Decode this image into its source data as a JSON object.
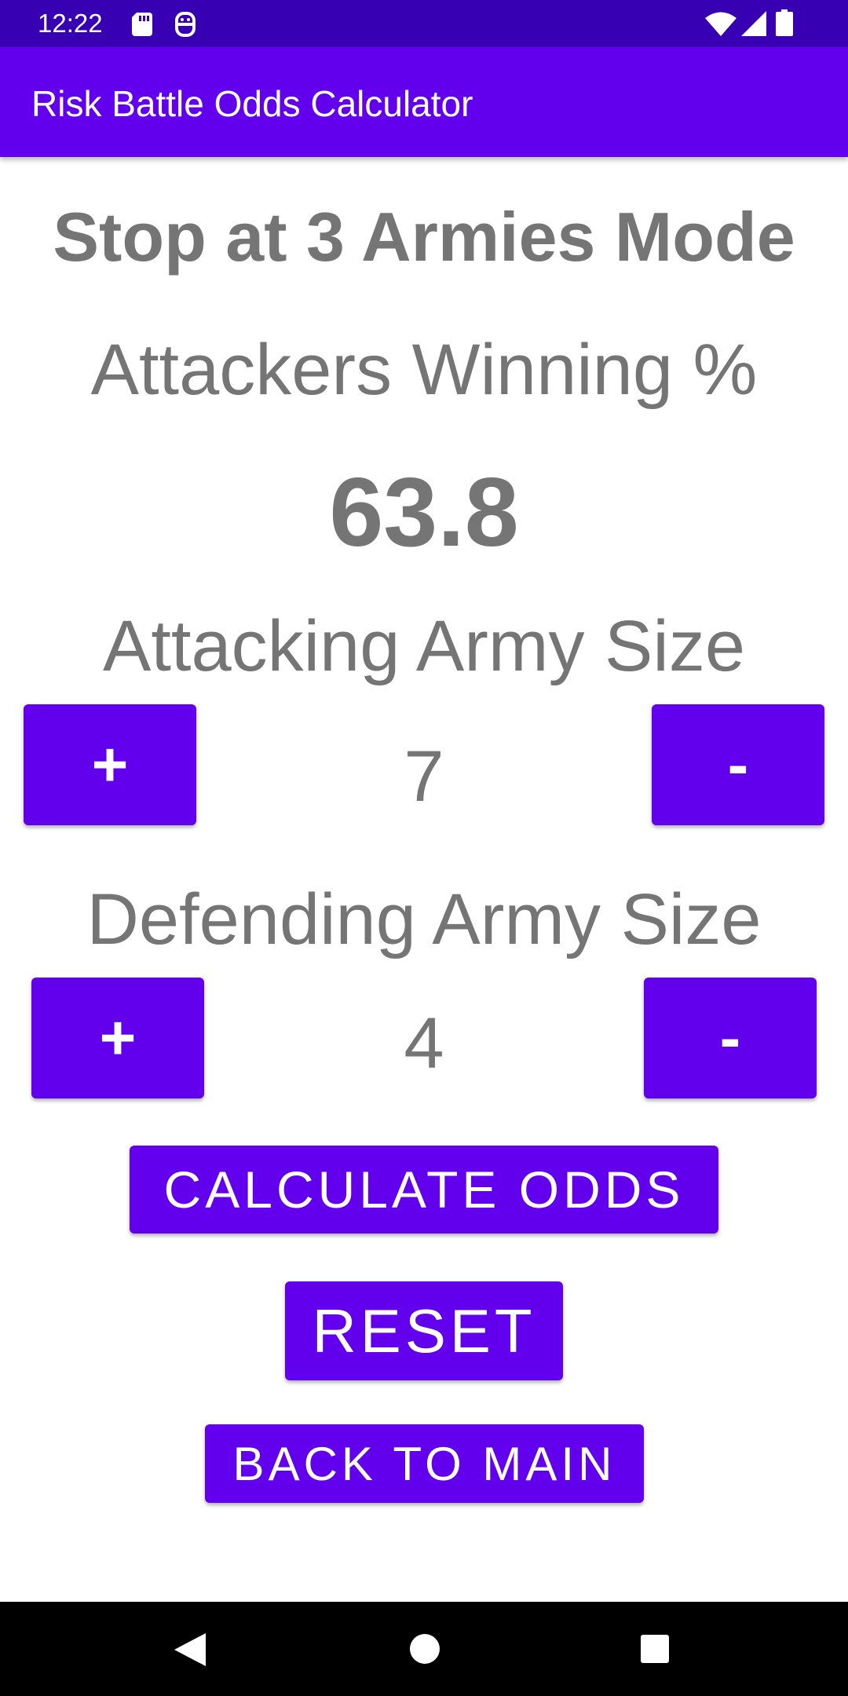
{
  "status_bar": {
    "time": "12:22",
    "icons": [
      "sd-card-icon",
      "assistant-icon",
      "wifi-icon",
      "cell-signal-icon",
      "battery-icon"
    ]
  },
  "app_bar": {
    "title": "Risk Battle Odds Calculator"
  },
  "main": {
    "mode_title": "Stop at 3 Armies Mode",
    "win_label": "Attackers Winning %",
    "win_value": "63.8",
    "attacking": {
      "label": "Attacking Army Size",
      "value": "7",
      "plus_label": "+",
      "minus_label": "-"
    },
    "defending": {
      "label": "Defending Army Size",
      "value": "4",
      "plus_label": "+",
      "minus_label": "-"
    },
    "calculate_label": "CALCULATE ODDS",
    "reset_label": "RESET",
    "back_label": "BACK TO MAIN"
  },
  "nav_bar": {
    "icons": [
      "back-icon",
      "home-icon",
      "recents-icon"
    ]
  },
  "colors": {
    "status_bar": "#3700b3",
    "primary": "#6200ee",
    "text_gray": "#757575",
    "nav_bar": "#000000"
  }
}
